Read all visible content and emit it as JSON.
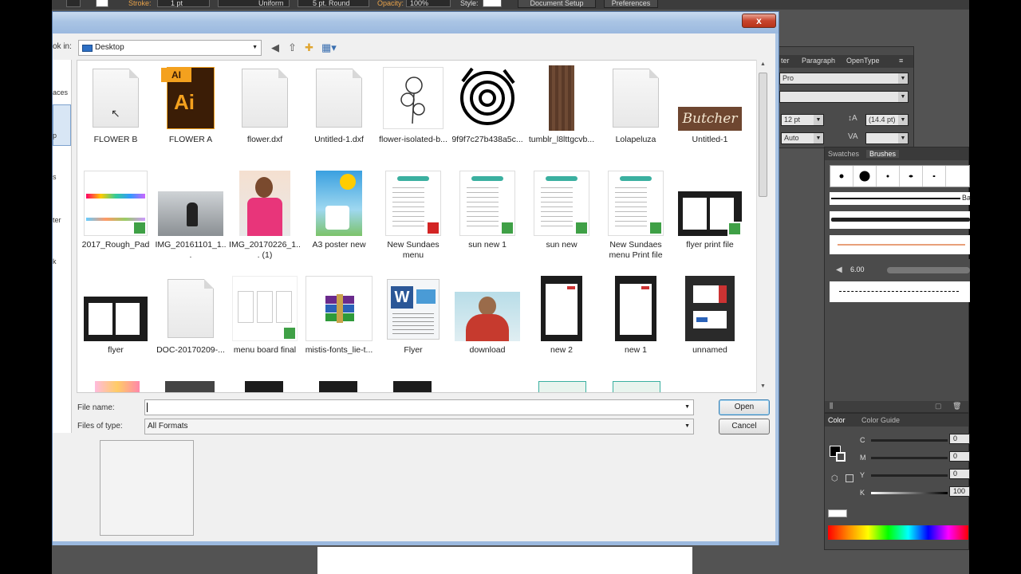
{
  "toolbar": {
    "stroke_label": "Stroke:",
    "stroke_weight": "1 pt",
    "profile": "Uniform",
    "brush": "5 pt. Round",
    "opacity_label": "Opacity:",
    "opacity_value": "100%",
    "style_label": "Style:",
    "document_setup": "Document Setup",
    "preferences": "Preferences"
  },
  "dialog": {
    "close": "x",
    "look_in_label": "ok in:",
    "look_in_value": "Desktop",
    "places": [
      "aces",
      "p",
      "s",
      "ter",
      "k"
    ],
    "file_name_label": "File name:",
    "file_name_value": "",
    "files_of_type_label": "Files of type:",
    "files_of_type_value": "All Formats",
    "open_button": "Open",
    "cancel_button": "Cancel",
    "files": [
      {
        "name": "FLOWER B",
        "kind": "doc"
      },
      {
        "name": "FLOWER A",
        "kind": "ai",
        "badge": "Ai",
        "tag": "AI"
      },
      {
        "name": "flower.dxf",
        "kind": "doc"
      },
      {
        "name": "Untitled-1.dxf",
        "kind": "doc"
      },
      {
        "name": "flower-isolated-b...",
        "kind": "sketch"
      },
      {
        "name": "9f9f7c27b438a5c...",
        "kind": "rose"
      },
      {
        "name": "tumblr_l8lttgcvb...",
        "kind": "wood"
      },
      {
        "name": "Lolapeluza",
        "kind": "doc"
      },
      {
        "name": "Untitled-1",
        "kind": "butcher",
        "text": "Butcher"
      },
      {
        "name": "2017_Rough_Pad",
        "kind": "pad"
      },
      {
        "name": "IMG_20161101_1...",
        "kind": "photo-gray"
      },
      {
        "name": "IMG_20170226_1... (1)",
        "kind": "photo-person"
      },
      {
        "name": "A3 poster new",
        "kind": "poster"
      },
      {
        "name": "New Sundaes menu",
        "kind": "menu-pdf"
      },
      {
        "name": "sun new 1",
        "kind": "menu"
      },
      {
        "name": "sun new",
        "kind": "menu"
      },
      {
        "name": "New Sundaes menu Print file",
        "kind": "menu"
      },
      {
        "name": "flyer print file",
        "kind": "flyer"
      },
      {
        "name": "flyer",
        "kind": "flyer"
      },
      {
        "name": "DOC-20170209-...",
        "kind": "doc"
      },
      {
        "name": "menu board final",
        "kind": "board"
      },
      {
        "name": "mistis-fonts_lie-t...",
        "kind": "rar"
      },
      {
        "name": "Flyer",
        "kind": "word"
      },
      {
        "name": "download",
        "kind": "jesus"
      },
      {
        "name": "new 2",
        "kind": "dark-page"
      },
      {
        "name": "new 1",
        "kind": "dark-page"
      },
      {
        "name": "unnamed",
        "kind": "cards"
      }
    ]
  },
  "character_panel": {
    "tabs": [
      "ter",
      "Paragraph",
      "OpenType"
    ],
    "font_family": "Pro",
    "font_size": "12 pt",
    "leading": "(14.4 pt)",
    "tracking": "Auto"
  },
  "brushes_panel": {
    "tabs": [
      "Swatches",
      "Brushes"
    ],
    "size_readout": "6.00",
    "edge_label": "Ba"
  },
  "color_panel": {
    "tabs": [
      "Color",
      "Color Guide"
    ],
    "channels": [
      {
        "label": "C",
        "value": "0",
        "color": "#3a7bd5"
      },
      {
        "label": "M",
        "value": "0",
        "color": "#d53a7b"
      },
      {
        "label": "Y",
        "value": "0",
        "color": "#d5c23a"
      },
      {
        "label": "K",
        "value": "100",
        "color": "#111111"
      }
    ]
  }
}
